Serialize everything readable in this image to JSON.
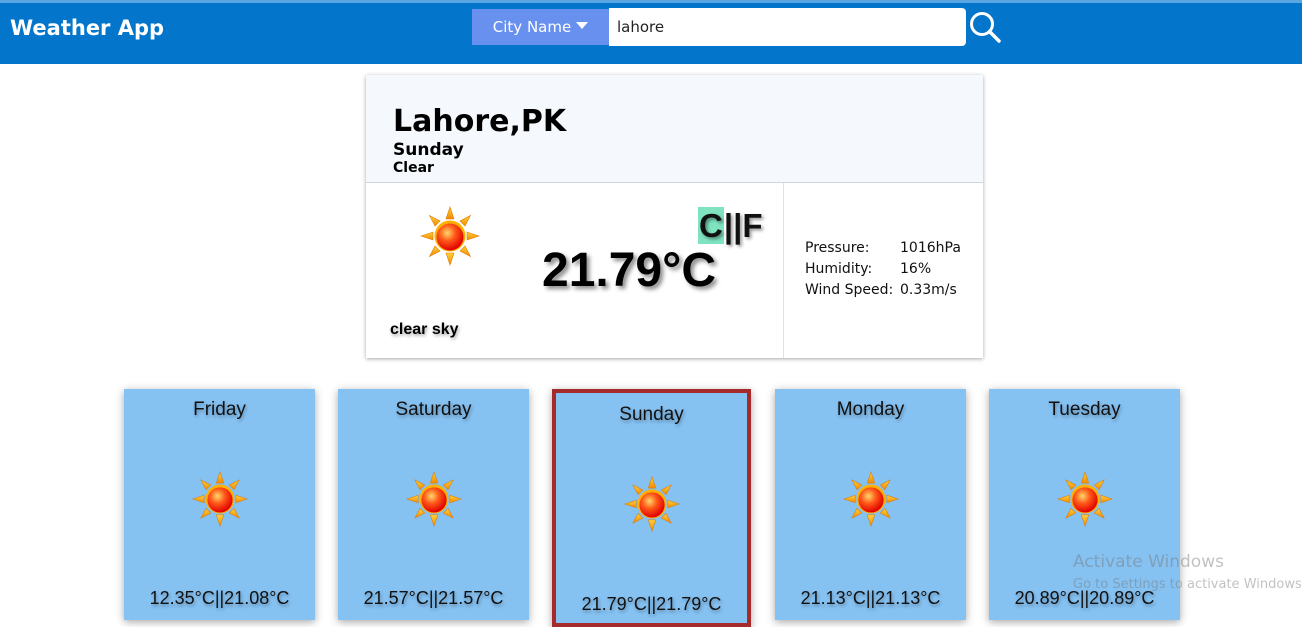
{
  "header": {
    "app_title": "Weather App",
    "city_select_label": "City Name",
    "search_value": "lahore",
    "background_color": "#0376cc",
    "select_color": "#6891ef",
    "search_icon": "search-icon"
  },
  "current": {
    "location": "Lahore,PK",
    "day": "Sunday",
    "condition": "Clear",
    "weather_icon": "sun-icon",
    "unit_c": "C",
    "unit_sep": "||",
    "unit_f": "F",
    "temperature": "21.79°C",
    "description": "clear sky",
    "details": [
      {
        "label": "Pressure:",
        "value": "1016hPa"
      },
      {
        "label": "Humidity:",
        "value": "16%"
      },
      {
        "label": "Wind Speed:",
        "value": "0.33m/s"
      }
    ]
  },
  "forecast": [
    {
      "day": "Friday",
      "temp": "12.35°C||21.08°C",
      "icon": "sun-icon",
      "selected": false
    },
    {
      "day": "Saturday",
      "temp": "21.57°C||21.57°C",
      "icon": "sun-icon",
      "selected": false
    },
    {
      "day": "Sunday",
      "temp": "21.79°C||21.79°C",
      "icon": "sun-icon",
      "selected": true
    },
    {
      "day": "Monday",
      "temp": "21.13°C||21.13°C",
      "icon": "sun-icon",
      "selected": false
    },
    {
      "day": "Tuesday",
      "temp": "20.89°C||20.89°C",
      "icon": "sun-icon",
      "selected": false
    }
  ],
  "colors": {
    "tile_background": "#85c1f1",
    "selected_border": "#a52a2a",
    "unit_highlight": "#7fe3c0"
  },
  "watermark": {
    "line1": "Activate Windows",
    "line2": "Go to Settings to activate Windows."
  }
}
